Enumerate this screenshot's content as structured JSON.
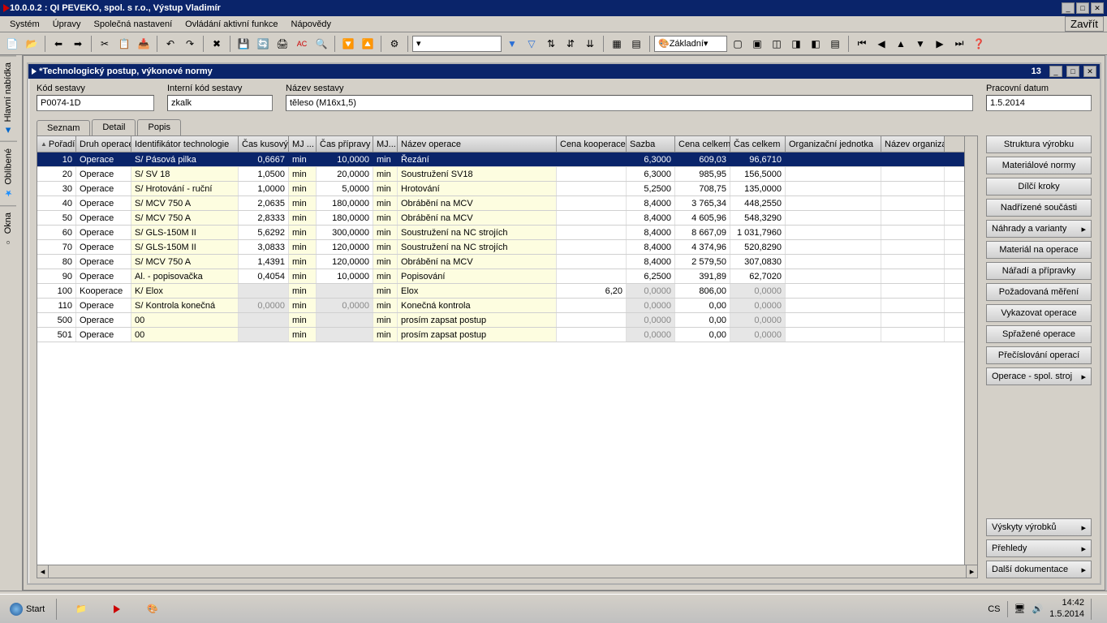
{
  "app": {
    "title": "10.0.0.2 : QI  PEVEKO, spol. s r.o., Výstup Vladimír",
    "close_label": "Zavřít"
  },
  "menu": [
    "Systém",
    "Úpravy",
    "Společná nastavení",
    "Ovládání aktivní funkce",
    "Nápovědy"
  ],
  "toolbar_combo": "Základní",
  "leftbar": [
    "Hlavní nabídka",
    "Oblíbené",
    "Okna"
  ],
  "mdi": {
    "title": "*Technologický postup, výkonové normy",
    "number": "13"
  },
  "form": {
    "kod": {
      "label": "Kód sestavy",
      "value": "P0074-1D"
    },
    "int": {
      "label": "Interní kód sestavy",
      "value": "zkalk"
    },
    "naz": {
      "label": "Název sestavy",
      "value": "těleso (M16x1,5)"
    },
    "date": {
      "label": "Pracovní datum",
      "value": "1.5.2014"
    }
  },
  "tabs": [
    "Seznam",
    "Detail",
    "Popis"
  ],
  "columns": [
    "Pořadí",
    "Druh operace",
    "Identifikátor technologie",
    "Čas kusový",
    "MJ ...",
    "Čas přípravy",
    "MJ...",
    "Název operace",
    "Cena kooperace",
    "Sazba",
    "Cena celkem",
    "Čas celkem",
    "Organizační jednotka",
    "Název organiza"
  ],
  "rows": [
    {
      "poradi": "10",
      "druh": "Operace",
      "tech": "S/ Pásová pilka",
      "kusovy": "0,6667",
      "mj1": "min",
      "priprava": "10,0000",
      "mj2": "min",
      "nazev": "Řezání",
      "koop": "",
      "sazba": "6,3000",
      "cena": "609,03",
      "cas": "96,6710",
      "org": "",
      "norg": "",
      "sel": true
    },
    {
      "poradi": "20",
      "druh": "Operace",
      "tech": "S/ SV 18",
      "kusovy": "1,0500",
      "mj1": "min",
      "priprava": "20,0000",
      "mj2": "min",
      "nazev": "Soustružení SV18",
      "koop": "",
      "sazba": "6,3000",
      "cena": "985,95",
      "cas": "156,5000",
      "org": "",
      "norg": ""
    },
    {
      "poradi": "30",
      "druh": "Operace",
      "tech": "S/ Hrotování - ruční",
      "kusovy": "1,0000",
      "mj1": "min",
      "priprava": "5,0000",
      "mj2": "min",
      "nazev": "Hrotování",
      "koop": "",
      "sazba": "5,2500",
      "cena": "708,75",
      "cas": "135,0000",
      "org": "",
      "norg": ""
    },
    {
      "poradi": "40",
      "druh": "Operace",
      "tech": "S/ MCV 750 A",
      "kusovy": "2,0635",
      "mj1": "min",
      "priprava": "180,0000",
      "mj2": "min",
      "nazev": "Obrábění na MCV",
      "koop": "",
      "sazba": "8,4000",
      "cena": "3 765,34",
      "cas": "448,2550",
      "org": "",
      "norg": ""
    },
    {
      "poradi": "50",
      "druh": "Operace",
      "tech": "S/ MCV 750 A",
      "kusovy": "2,8333",
      "mj1": "min",
      "priprava": "180,0000",
      "mj2": "min",
      "nazev": "Obrábění na MCV",
      "koop": "",
      "sazba": "8,4000",
      "cena": "4 605,96",
      "cas": "548,3290",
      "org": "",
      "norg": ""
    },
    {
      "poradi": "60",
      "druh": "Operace",
      "tech": "S/ GLS-150M II",
      "kusovy": "5,6292",
      "mj1": "min",
      "priprava": "300,0000",
      "mj2": "min",
      "nazev": "Soustružení na NC strojích",
      "koop": "",
      "sazba": "8,4000",
      "cena": "8 667,09",
      "cas": "1 031,7960",
      "org": "",
      "norg": ""
    },
    {
      "poradi": "70",
      "druh": "Operace",
      "tech": "S/ GLS-150M II",
      "kusovy": "3,0833",
      "mj1": "min",
      "priprava": "120,0000",
      "mj2": "min",
      "nazev": "Soustružení na NC strojích",
      "koop": "",
      "sazba": "8,4000",
      "cena": "4 374,96",
      "cas": "520,8290",
      "org": "",
      "norg": ""
    },
    {
      "poradi": "80",
      "druh": "Operace",
      "tech": "S/ MCV 750 A",
      "kusovy": "1,4391",
      "mj1": "min",
      "priprava": "120,0000",
      "mj2": "min",
      "nazev": "Obrábění na MCV",
      "koop": "",
      "sazba": "8,4000",
      "cena": "2 579,50",
      "cas": "307,0830",
      "org": "",
      "norg": ""
    },
    {
      "poradi": "90",
      "druh": "Operace",
      "tech": "Al. - popisovačka",
      "kusovy": "0,4054",
      "mj1": "min",
      "priprava": "10,0000",
      "mj2": "min",
      "nazev": "Popisování",
      "koop": "",
      "sazba": "6,2500",
      "cena": "391,89",
      "cas": "62,7020",
      "org": "",
      "norg": ""
    },
    {
      "poradi": "100",
      "druh": "Kooperace",
      "tech": "K/ Elox",
      "kusovy": "",
      "mj1": "min",
      "priprava": "",
      "mj2": "min",
      "nazev": "Elox",
      "koop": "6,20",
      "sazba": "0,0000",
      "cena": "806,00",
      "cas": "0,0000",
      "org": "",
      "norg": "",
      "grey": true
    },
    {
      "poradi": "110",
      "druh": "Operace",
      "tech": "S/ Kontrola konečná",
      "kusovy": "0,0000",
      "mj1": "min",
      "priprava": "0,0000",
      "mj2": "min",
      "nazev": "Konečná kontrola",
      "koop": "",
      "sazba": "0,0000",
      "cena": "0,00",
      "cas": "0,0000",
      "org": "",
      "norg": "",
      "grey": true
    },
    {
      "poradi": "500",
      "druh": "Operace",
      "tech": "00",
      "kusovy": "",
      "mj1": "min",
      "priprava": "",
      "mj2": "min",
      "nazev": "prosím zapsat postup",
      "koop": "",
      "sazba": "0,0000",
      "cena": "0,00",
      "cas": "0,0000",
      "org": "",
      "norg": "",
      "grey": true
    },
    {
      "poradi": "501",
      "druh": "Operace",
      "tech": "00",
      "kusovy": "",
      "mj1": "min",
      "priprava": "",
      "mj2": "min",
      "nazev": "prosím zapsat postup",
      "koop": "",
      "sazba": "0,0000",
      "cena": "0,00",
      "cas": "0,0000",
      "org": "",
      "norg": "",
      "grey": true
    }
  ],
  "side": {
    "top": [
      "Struktura výrobku",
      "Materiálové normy",
      "Dílčí kroky",
      "Nadřízené součásti",
      "Náhrady a varianty",
      "Materiál na operace",
      "Nářadí a přípravky",
      "Požadovaná měření",
      "Vykazovat operace",
      "Spřažené operace",
      "Přečíslování operací",
      "Operace - spol. stroj"
    ],
    "bottom": [
      "Výskyty výrobků",
      "Přehledy",
      "Další dokumentace"
    ]
  },
  "taskbar": {
    "start": "Start",
    "lang": "CS",
    "time": "14:42",
    "date": "1.5.2014"
  }
}
